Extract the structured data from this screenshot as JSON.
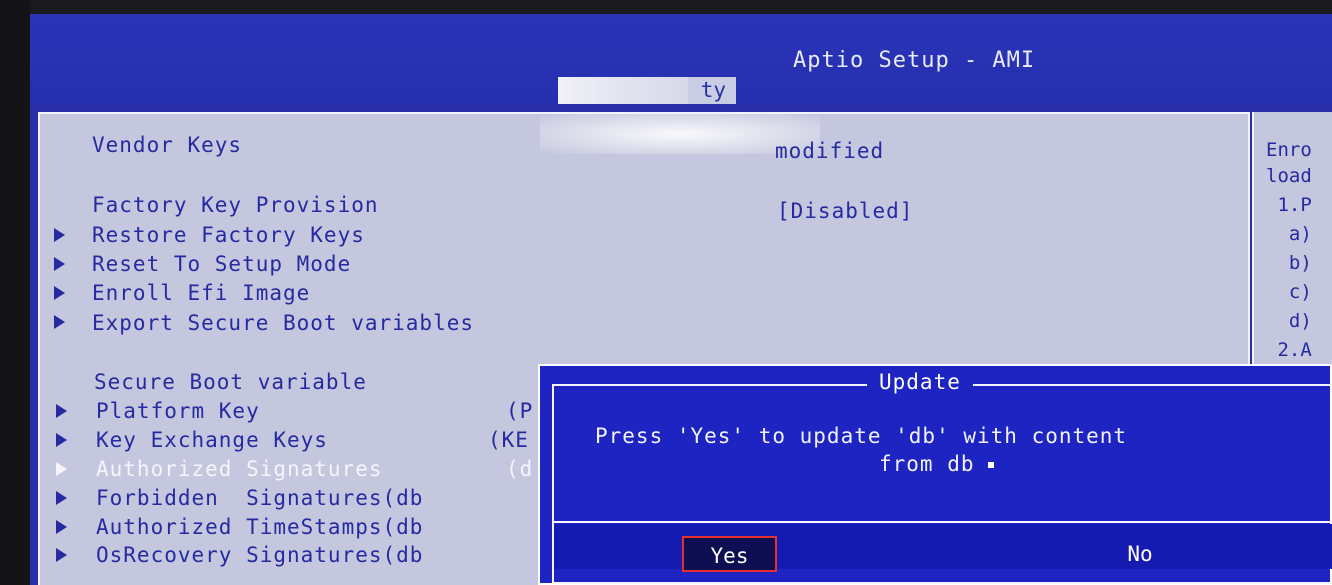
{
  "header": {
    "title": "Aptio Setup - AMI",
    "tab": "ty"
  },
  "vendor_keys": {
    "label": "Vendor Keys",
    "value": "modified"
  },
  "factory_key_provision": {
    "label": "Factory Key Provision",
    "value": "[Disabled]"
  },
  "menu_items": [
    "Restore Factory Keys",
    "Reset To Setup Mode",
    "Enroll Efi Image",
    "Export Secure Boot variables"
  ],
  "secure_boot_variable": "Secure Boot variable",
  "variables": [
    {
      "label": "Platform Key",
      "value": "(P"
    },
    {
      "label": "Key Exchange Keys",
      "value": "(KE"
    },
    {
      "label": "Authorized Signatures",
      "value": "(d"
    },
    {
      "label": "Forbidden  Signatures(db",
      "value": ""
    },
    {
      "label": "Authorized TimeStamps(db",
      "value": ""
    },
    {
      "label": "OsRecovery Signatures(db",
      "value": ""
    }
  ],
  "help": [
    "Enro",
    "load",
    " 1.P",
    "  a)",
    "  b)",
    "  c)",
    "  d)",
    " 2.A"
  ],
  "dialog": {
    "title": "Update",
    "message_line1": "Press 'Yes' to update 'db' with content",
    "message_line2": "from db",
    "yes": "Yes",
    "no": "No"
  }
}
